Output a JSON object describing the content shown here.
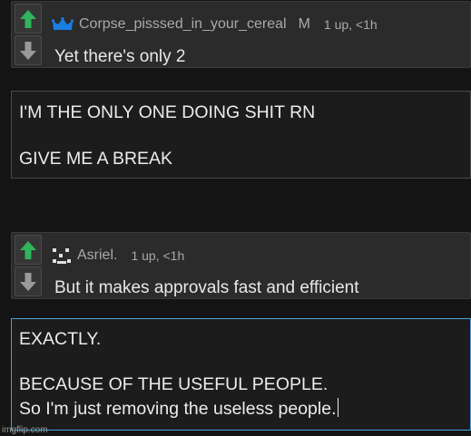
{
  "comments": [
    {
      "username": "Corpse_pisssed_in_your_cereal",
      "badge": "M",
      "stats": "1 up, <1h",
      "text": "Yet there's only 2",
      "avatar_icon": "crown-icon"
    },
    {
      "username": "Asriel.",
      "stats": "1 up, <1h",
      "text": "But it makes approvals fast and efficient",
      "avatar_icon": "pixel-face-icon"
    }
  ],
  "reply_boxes": [
    {
      "lines": [
        "I'M THE ONLY ONE DOING SHIT RN",
        "GIVE ME A BREAK"
      ]
    },
    {
      "lines": [
        "EXACTLY.",
        "BECAUSE OF THE USEFUL PEOPLE.",
        "So I'm just removing the useless people."
      ]
    }
  ],
  "colors": {
    "upvote": "#31b35c",
    "downvote": "#9a9a9a",
    "crown": "#1a7de0",
    "active_border": "#4aa3d6"
  },
  "watermark": "imgflip.com"
}
